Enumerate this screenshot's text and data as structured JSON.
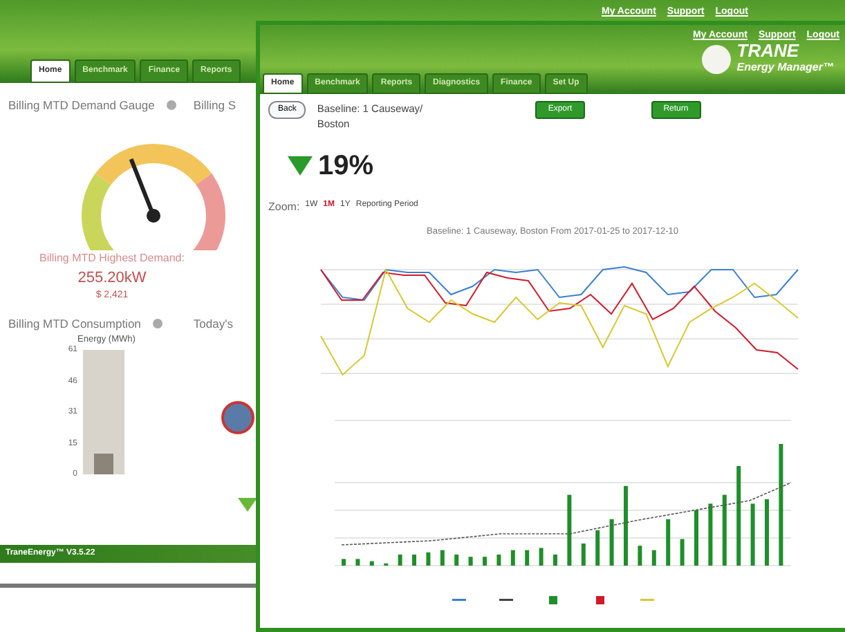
{
  "back_window": {
    "links": [
      "My Account",
      "Support",
      "Logout"
    ],
    "tabs": [
      {
        "label": "Home",
        "selected": true
      },
      {
        "label": "Benchmark",
        "selected": false
      },
      {
        "label": "Finance",
        "selected": false
      },
      {
        "label": "Reports",
        "selected": false
      }
    ],
    "gauge_panel": {
      "title": "Billing MTD Demand Gauge",
      "level": 0.42,
      "highest_label": "Billing MTD Highest Demand:",
      "highest_value": "255.20kW",
      "cost": "$ 2,421"
    },
    "side_panel_title": "Billing S",
    "consumption_panel": {
      "title": "Billing MTD Consumption",
      "axis_title": "Energy (MWh)",
      "axis_labels": [
        "61",
        "46",
        "31",
        "15",
        "0"
      ],
      "level": 0.17
    },
    "today_panel_title": "Today's",
    "footer": "TraneEnergy™ V3.5.22"
  },
  "front_window": {
    "links": [
      "My Account",
      "Support",
      "Logout"
    ],
    "logo": {
      "brand": "TRANE",
      "product": "Energy Manager™"
    },
    "tabs": [
      {
        "label": "Home",
        "selected": true
      },
      {
        "label": "Benchmark",
        "selected": false
      },
      {
        "label": "Reports",
        "selected": false
      },
      {
        "label": "Diagnostics",
        "selected": false
      },
      {
        "label": "Finance",
        "selected": false
      },
      {
        "label": "Set Up",
        "selected": false
      }
    ],
    "back_button": "Back",
    "site": "Baseline: 1 Causeway/ Boston",
    "buttons": [
      "Export",
      "Return"
    ],
    "savings": "19%",
    "zoom_label": "Zoom:",
    "zoom_options": [
      {
        "label": "1W",
        "selected": false
      },
      {
        "label": "1M",
        "selected": true
      },
      {
        "label": "1Y",
        "selected": false
      },
      {
        "label": "Reporting Period",
        "selected": false
      }
    ],
    "chart_title": "Baseline: 1 Causeway, Boston From 2017-01-25 to 2017-12-10",
    "legend": [
      {
        "kind": "line",
        "color": "#3b7fd0"
      },
      {
        "kind": "line",
        "color": "#444444"
      },
      {
        "kind": "box",
        "color": "#1f8f2a"
      },
      {
        "kind": "box",
        "color": "#d01a2a"
      },
      {
        "kind": "line",
        "color": "#d8c830"
      }
    ]
  }
}
